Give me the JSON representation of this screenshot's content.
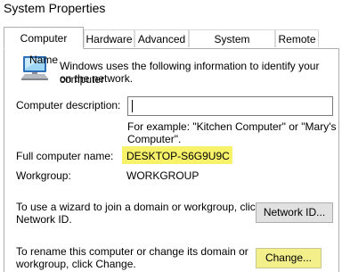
{
  "window": {
    "title": "System Properties"
  },
  "tabs": [
    {
      "label": "Computer Name"
    },
    {
      "label": "Hardware"
    },
    {
      "label": "Advanced"
    },
    {
      "label": "System Protection"
    },
    {
      "label": "Remote"
    }
  ],
  "intro": {
    "line1": "Windows uses the following information to identify your computer",
    "line2": "on the network."
  },
  "description": {
    "label": "Computer description:",
    "value": "",
    "example_line1": "For example: \"Kitchen Computer\" or \"Mary's",
    "example_line2": "Computer\"."
  },
  "full_name": {
    "label": "Full computer name:",
    "value": "DESKTOP-S6G9U9C"
  },
  "workgroup": {
    "label": "Workgroup:",
    "value": "WORKGROUP"
  },
  "network_id": {
    "text_line1": "To use a wizard to join a domain or workgroup, click",
    "text_line2": "Network ID.",
    "button_label": "Network ID..."
  },
  "change": {
    "text_line1": "To rename this computer or change its domain or",
    "text_line2": "workgroup, click Change.",
    "button_label": "Change..."
  },
  "colors": {
    "highlight": "#f7f26a",
    "border": "#adadad",
    "button_face": "#e1e1e1"
  }
}
